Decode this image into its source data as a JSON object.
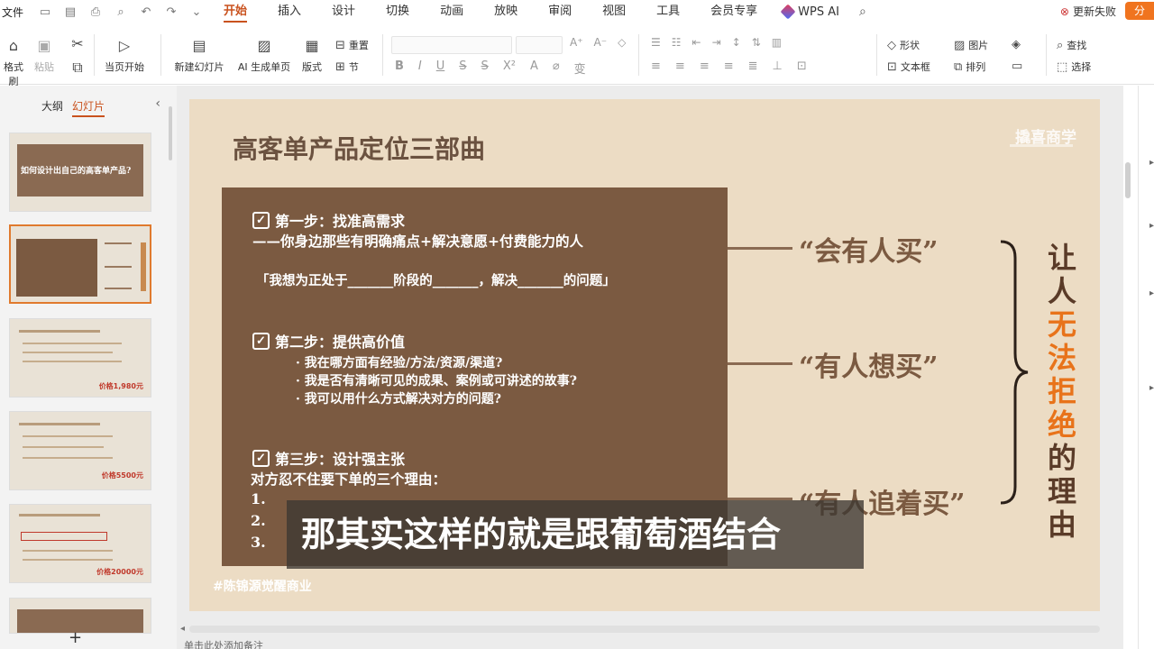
{
  "menubar": {
    "file": "文件",
    "tabs": [
      "开始",
      "插入",
      "设计",
      "切换",
      "动画",
      "放映",
      "审阅",
      "视图",
      "工具",
      "会员专享"
    ],
    "active_tab": "开始",
    "wps_ai": "WPS AI",
    "update_status": "更新失败",
    "share": "分"
  },
  "ribbon": {
    "format_painter": "格式刷",
    "paste": "粘贴",
    "play_from_current": "当页开始",
    "new_slide": "新建幻灯片",
    "ai_generate": "AI 生成单页",
    "layout": "版式",
    "reset": "重置",
    "section": "节",
    "shape": "形状",
    "picture": "图片",
    "textbox": "文本框",
    "arrange": "排列",
    "find": "查找",
    "select": "选择"
  },
  "left_panel": {
    "tab_outline": "大纲",
    "tab_slides": "幻灯片",
    "slide1_title": "如何设计出自己的高客单产品?",
    "slide3_price": "价格1,980元",
    "slide4_price": "价格5500元",
    "slide5_price": "价格20000元"
  },
  "slide": {
    "title": "高客单产品定位三部曲",
    "brand": "撬喜商学",
    "step1_title": "第一步：找准高需求",
    "step1_line": "——你身边那些有明确痛点+解决意愿+付费能力的人",
    "step1_fill": "「我想为正处于_______阶段的_______，解决_______的问题」",
    "step2_title": "第二步：提供高价值",
    "step2_b1": "· 我在哪方面有经验/方法/资源/渠道?",
    "step2_b2": "· 我是否有清晰可见的成果、案例或可讲述的故事?",
    "step2_b3": "· 我可以用什么方式解决对方的问题?",
    "step3_title": "第三步：设计强主张",
    "step3_line": "对方忍不住要下单的三个理由：",
    "num1": "1.",
    "num2": "2.",
    "num3": "3.",
    "quote1": "“会有人买”",
    "quote2": "“有人想买”",
    "quote3": "“有人追着买”",
    "vertical_chars": [
      "让",
      "人",
      "无",
      "法",
      "拒",
      "绝",
      "的",
      "理",
      "由"
    ],
    "footer_tag": "#陈锦源觉醒商业"
  },
  "subtitle": "那其实这样的就是跟葡萄酒结合",
  "notes_placeholder": "单击此处添加备注",
  "colors": {
    "accent": "#c9521e",
    "slide_bg": "#ecdcc4",
    "box_bg": "#7b5a41",
    "dark_text": "#5a3b28",
    "highlight": "#e8731a"
  }
}
